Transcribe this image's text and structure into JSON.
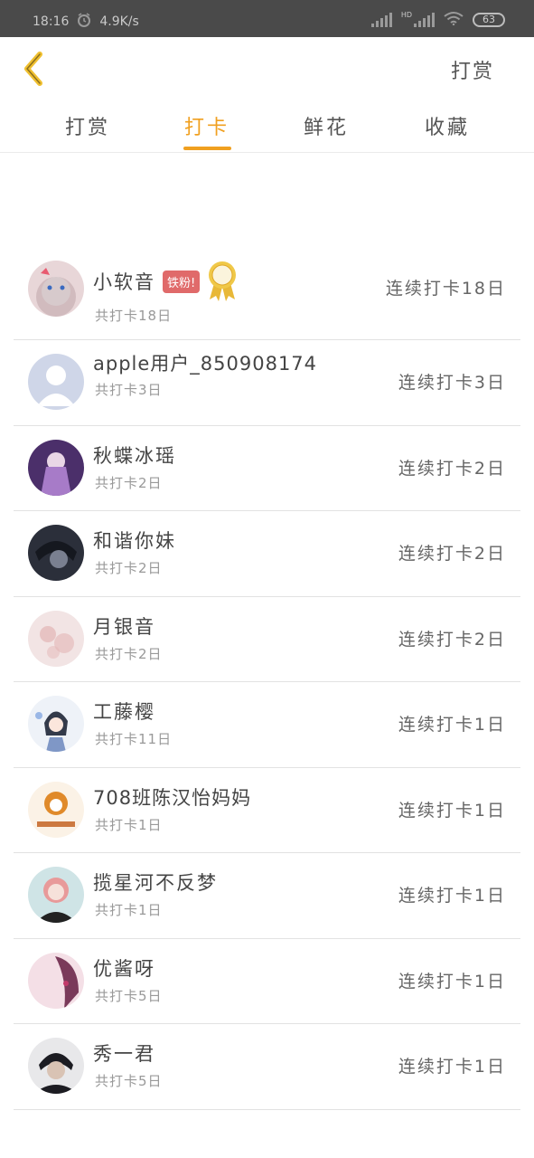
{
  "status": {
    "time": "18:16",
    "speed": "4.9K/s",
    "network": "HD",
    "battery": "63"
  },
  "header": {
    "action": "打赏"
  },
  "tabs": [
    {
      "label": "打赏",
      "active": false
    },
    {
      "label": "打卡",
      "active": true
    },
    {
      "label": "鲜花",
      "active": false
    },
    {
      "label": "收藏",
      "active": false
    }
  ],
  "list": [
    {
      "name": "小软音",
      "badge": "铁粉!",
      "medal": "medal-icon",
      "sub": "共打卡18日",
      "streak": "连续打卡18日",
      "avatar": {
        "bg": "#e8d6d8",
        "fg": "#b9a0a4"
      }
    },
    {
      "name": "apple用户_850908174",
      "sub": "共打卡3日",
      "streak": "连续打卡3日",
      "avatar": {
        "bg": "#cfd6e8",
        "fg": "#ffffff"
      }
    },
    {
      "name": "秋蝶冰瑶",
      "sub": "共打卡2日",
      "streak": "连续打卡2日",
      "avatar": {
        "bg": "#4b2f6a",
        "fg": "#a77bc8"
      }
    },
    {
      "name": "和谐你妹",
      "sub": "共打卡2日",
      "streak": "连续打卡2日",
      "avatar": {
        "bg": "#2b2f3a",
        "fg": "#7a8090"
      }
    },
    {
      "name": "月银音",
      "sub": "共打卡2日",
      "streak": "连续打卡2日",
      "avatar": {
        "bg": "#f2e4e4",
        "fg": "#e3b5b5"
      }
    },
    {
      "name": "工藤樱",
      "sub": "共打卡11日",
      "streak": "连续打卡1日",
      "avatar": {
        "bg": "#eef2f8",
        "fg": "#333a4a"
      }
    },
    {
      "name": "708班陈汉怡妈妈",
      "sub": "共打卡1日",
      "streak": "连续打卡1日",
      "avatar": {
        "bg": "#fbf2e6",
        "fg": "#e08a2a"
      }
    },
    {
      "name": "揽星河不反梦",
      "sub": "共打卡1日",
      "streak": "连续打卡1日",
      "avatar": {
        "bg": "#cfe4e6",
        "fg": "#e89a9a"
      }
    },
    {
      "name": "优酱呀",
      "sub": "共打卡5日",
      "streak": "连续打卡1日",
      "avatar": {
        "bg": "#f4dfe6",
        "fg": "#7a3a5a"
      }
    },
    {
      "name": "秀一君",
      "sub": "共打卡5日",
      "streak": "连续打卡1日",
      "avatar": {
        "bg": "#e8e8ea",
        "fg": "#1c1c22"
      }
    }
  ],
  "colors": {
    "accent": "#f0a020",
    "badge": "#e06a6a",
    "back_icon": "#f0c030"
  }
}
